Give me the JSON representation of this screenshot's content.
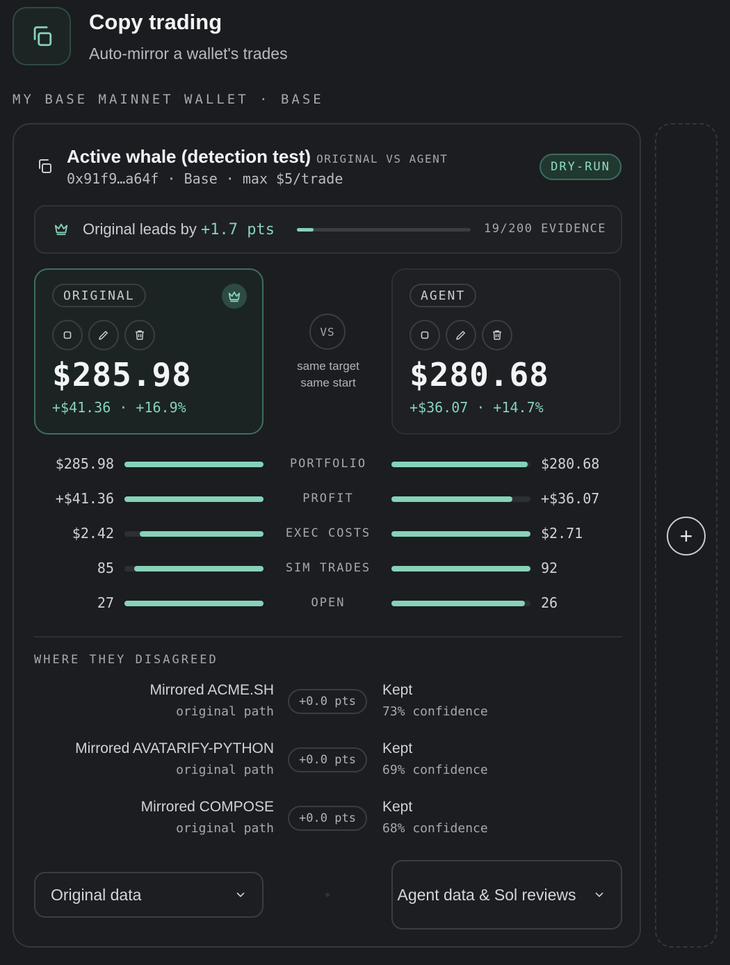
{
  "header": {
    "title": "Copy trading",
    "subtitle": "Auto-mirror a wallet's trades",
    "icon": "copy-icon"
  },
  "wallet_label": "MY BASE MAINNET WALLET · BASE",
  "trader": {
    "name": "Active whale (detection test)",
    "compare_tag": "ORIGINAL VS AGENT",
    "meta": "0x91f9…a64f · Base · max $5/trade",
    "mode_badge": "DRY-RUN"
  },
  "leader": {
    "prefix": "Original leads by",
    "points": "+1.7 pts",
    "evidence": "19/200 EVIDENCE",
    "evidence_progress": 0.095
  },
  "original": {
    "label": "ORIGINAL",
    "value": "$285.98",
    "delta": "+$41.36 · +16.9%",
    "leader": true
  },
  "agent": {
    "label": "AGENT",
    "value": "$280.68",
    "delta": "+$36.07 · +14.7%"
  },
  "vs": {
    "label": "VS",
    "note_line1": "same target",
    "note_line2": "same start"
  },
  "metrics": [
    {
      "label": "PORTFOLIO",
      "left": "$285.98",
      "right": "$280.68",
      "left_frac": 1.0,
      "right_frac": 0.98
    },
    {
      "label": "PROFIT",
      "left": "+$41.36",
      "right": "+$36.07",
      "left_frac": 1.0,
      "right_frac": 0.87
    },
    {
      "label": "EXEC COSTS",
      "left": "$2.42",
      "right": "$2.71",
      "left_frac": 0.89,
      "right_frac": 1.0
    },
    {
      "label": "SIM TRADES",
      "left": "85",
      "right": "92",
      "left_frac": 0.93,
      "right_frac": 1.0
    },
    {
      "label": "OPEN",
      "left": "27",
      "right": "26",
      "left_frac": 1.0,
      "right_frac": 0.96
    }
  ],
  "disagreements": {
    "title": "WHERE THEY DISAGREED",
    "items": [
      {
        "title": "Mirrored ACME.SH",
        "sub": "original path",
        "pts": "+0.0 pts",
        "result": "Kept",
        "confidence": "73% confidence"
      },
      {
        "title": "Mirrored AVATARIFY-PYTHON",
        "sub": "original path",
        "pts": "+0.0 pts",
        "result": "Kept",
        "confidence": "69% confidence"
      },
      {
        "title": "Mirrored COMPOSE",
        "sub": "original path",
        "pts": "+0.0 pts",
        "result": "Kept",
        "confidence": "68% confidence"
      }
    ]
  },
  "dropdowns": {
    "left": "Original data",
    "right": "Agent data & Sol reviews"
  },
  "add_label": "+",
  "colors": {
    "accent": "#86d2b8",
    "background": "#1a1c20",
    "card": "#1b1d21",
    "badge_bg": "#213830"
  }
}
